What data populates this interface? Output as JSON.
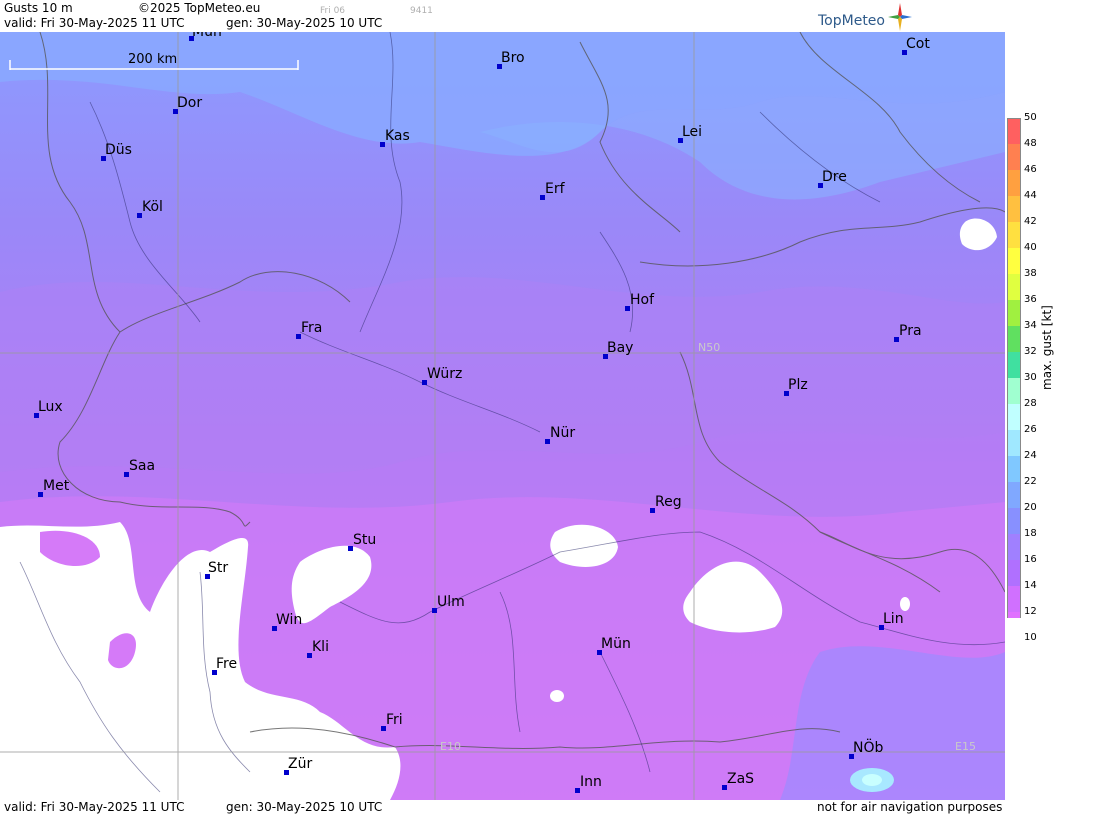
{
  "header": {
    "product": "Gusts 10 m",
    "copyright": "©2025 TopMeteo.eu",
    "weekday_marker": "Fri 06",
    "code": "9411",
    "valid_line": "valid:  Fri  30-May-2025  11 UTC",
    "gen_line": "gen: 30-May-2025 10 UTC",
    "logo_text": "TopMeteo"
  },
  "map": {
    "scale_bar_label": "200 km",
    "grid_labels": [
      "N50",
      "E10",
      "E15"
    ],
    "cities": [
      {
        "name": "Mün",
        "id": "mun-north"
      },
      {
        "name": "Bro",
        "id": "bro"
      },
      {
        "name": "Cot",
        "id": "cot"
      },
      {
        "name": "Dor",
        "id": "dor"
      },
      {
        "name": "Kas",
        "id": "kas"
      },
      {
        "name": "Lei",
        "id": "lei"
      },
      {
        "name": "Düs",
        "id": "dus"
      },
      {
        "name": "Erf",
        "id": "erf"
      },
      {
        "name": "Dre",
        "id": "dre"
      },
      {
        "name": "Köl",
        "id": "kol"
      },
      {
        "name": "Hof",
        "id": "hof"
      },
      {
        "name": "Fra",
        "id": "fra"
      },
      {
        "name": "Pra",
        "id": "pra"
      },
      {
        "name": "Bay",
        "id": "bay"
      },
      {
        "name": "Würz",
        "id": "wur"
      },
      {
        "name": "Plz",
        "id": "plz"
      },
      {
        "name": "Lux",
        "id": "lux"
      },
      {
        "name": "Nür",
        "id": "nur"
      },
      {
        "name": "Saa",
        "id": "saa"
      },
      {
        "name": "Met",
        "id": "met"
      },
      {
        "name": "Reg",
        "id": "reg"
      },
      {
        "name": "Stu",
        "id": "stu"
      },
      {
        "name": "Str",
        "id": "str"
      },
      {
        "name": "Ulm",
        "id": "ulm"
      },
      {
        "name": "Win",
        "id": "win"
      },
      {
        "name": "Lin",
        "id": "lin"
      },
      {
        "name": "Kli",
        "id": "kli"
      },
      {
        "name": "Mün",
        "id": "mun"
      },
      {
        "name": "Fre",
        "id": "fre"
      },
      {
        "name": "Fri",
        "id": "fri"
      },
      {
        "name": "NÖb",
        "id": "nob"
      },
      {
        "name": "Zür",
        "id": "zur"
      },
      {
        "name": "ZaS",
        "id": "zas"
      },
      {
        "name": "Inn",
        "id": "inn"
      }
    ]
  },
  "legend": {
    "title": "max. gust  [kt]",
    "ticks": [
      "50",
      "48",
      "46",
      "44",
      "42",
      "40",
      "38",
      "36",
      "34",
      "32",
      "30",
      "28",
      "26",
      "24",
      "22",
      "20",
      "18",
      "16",
      "14",
      "12",
      "10"
    ],
    "colors": [
      "#ff6060",
      "#ff8050",
      "#ffa040",
      "#ffc040",
      "#ffe040",
      "#ffff40",
      "#e0ff40",
      "#a0f040",
      "#60e060",
      "#40e0a0",
      "#a0ffd0",
      "#c0ffff",
      "#a0e8ff",
      "#80c8ff",
      "#80a8ff",
      "#8890ff",
      "#a080ff",
      "#b070ff",
      "#d070ff",
      "#e070ff"
    ]
  },
  "footer": {
    "valid_line": "valid:  Fri  30-May-2025  11 UTC",
    "gen_line": "gen: 30-May-2025 10 UTC",
    "disclaimer": "not for air navigation purposes"
  }
}
